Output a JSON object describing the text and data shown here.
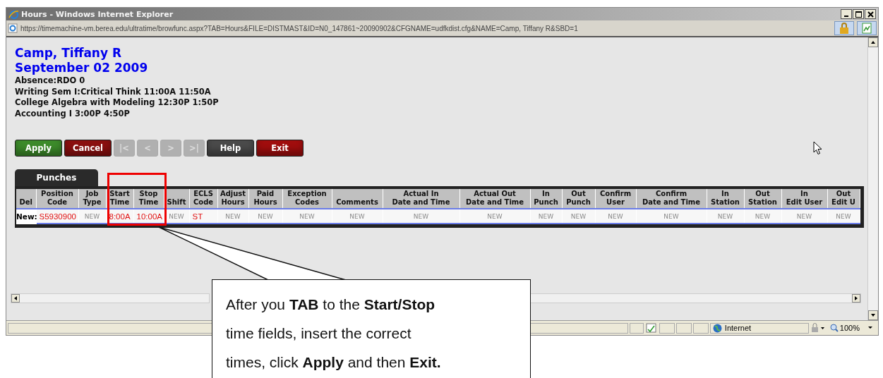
{
  "window": {
    "title": "Hours - Windows Internet Explorer"
  },
  "address_bar": {
    "url": "https://timemachine-vm.berea.edu/ultratime/browfunc.aspx?TAB=Hours&FILE=DISTMAST&ID=N0_147861~20090902&CFGNAME=udfkdist.cfg&NAME=Camp, Tiffany R&SBD=1"
  },
  "header": {
    "name": "Camp, Tiffany R",
    "date": "September 02 2009",
    "lines": [
      "Absence:RDO 0",
      "Writing Sem I:Critical Think 11:00A 11:50A",
      "College Algebra with Modeling 12:30P 1:50P",
      "Accounting I 3:00P 4:50P"
    ]
  },
  "buttons": [
    {
      "label": "Apply",
      "color": "#3c8a2a",
      "disabled": false
    },
    {
      "label": "Cancel",
      "color": "#8a0f0f",
      "disabled": false
    },
    {
      "label": "|<",
      "color": "#b0b0b0",
      "disabled": true
    },
    {
      "label": "<",
      "color": "#b0b0b0",
      "disabled": true
    },
    {
      "label": ">",
      "color": "#b0b0b0",
      "disabled": true
    },
    {
      "label": ">|",
      "color": "#b0b0b0",
      "disabled": true
    },
    {
      "label": "Help",
      "color": "#4a4a4a",
      "disabled": false
    },
    {
      "label": "Exit",
      "color": "#a00d0d",
      "disabled": false
    }
  ],
  "tabs": [
    {
      "label": "Punches",
      "selected": true
    }
  ],
  "table": {
    "columns": [
      "Del",
      "Position\nCode",
      "Job\nType",
      "Start\nTime",
      "Stop\nTime",
      "Shift",
      "ECLS\nCode",
      "Adjust\nHours",
      "Paid\nHours",
      "Exception\nCodes",
      "Comments",
      "Actual In\nDate and Time",
      "Actual Out\nDate and Time",
      "In\nPunch",
      "Out\nPunch",
      "Confirm\nUser",
      "Confirm\nDate and Time",
      "In\nStation",
      "Out\nStation",
      "In\nEdit User",
      "Out\nEdit U"
    ],
    "rows": [
      {
        "cells": [
          {
            "text": "New:",
            "kind": "label"
          },
          {
            "text": "S5930900",
            "kind": "value"
          },
          {
            "text": "NEW",
            "kind": "empty"
          },
          {
            "text": "8:00A",
            "kind": "value"
          },
          {
            "text": "10:00A",
            "kind": "value"
          },
          {
            "text": "NEW",
            "kind": "empty"
          },
          {
            "text": "ST",
            "kind": "value"
          },
          {
            "text": "NEW",
            "kind": "empty"
          },
          {
            "text": "NEW",
            "kind": "empty"
          },
          {
            "text": "NEW",
            "kind": "empty"
          },
          {
            "text": "NEW",
            "kind": "empty"
          },
          {
            "text": "NEW",
            "kind": "empty"
          },
          {
            "text": "NEW",
            "kind": "empty"
          },
          {
            "text": "NEW",
            "kind": "empty"
          },
          {
            "text": "NEW",
            "kind": "empty"
          },
          {
            "text": "NEW",
            "kind": "empty"
          },
          {
            "text": "NEW",
            "kind": "empty"
          },
          {
            "text": "NEW",
            "kind": "empty"
          },
          {
            "text": "NEW",
            "kind": "empty"
          },
          {
            "text": "NEW",
            "kind": "empty"
          },
          {
            "text": "NEW",
            "kind": "empty"
          }
        ]
      }
    ]
  },
  "status_bar": {
    "zone": "Internet",
    "zoom": "100%"
  },
  "callout": {
    "text": "After you **TAB** to the **Start/Stop** time fields, insert the correct times, click **Apply** and then **Exit.**"
  }
}
